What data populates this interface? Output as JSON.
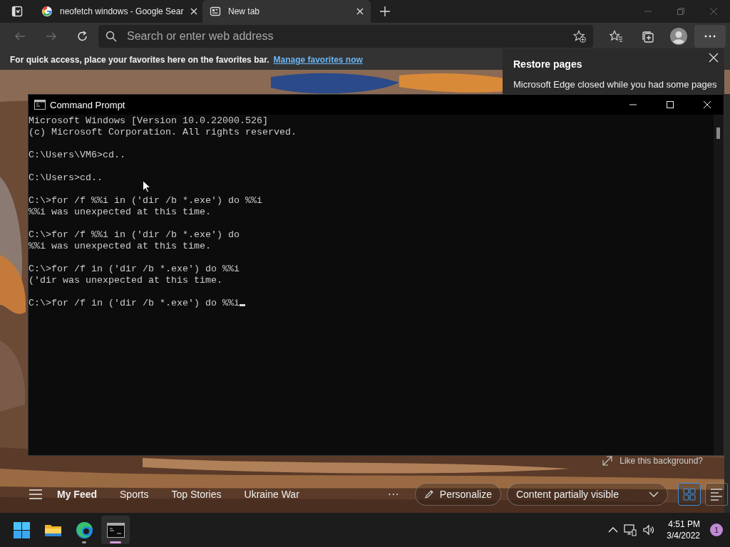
{
  "browser": {
    "tabs": [
      {
        "title": "neofetch windows - Google Sear",
        "kind": "google",
        "selected": false
      },
      {
        "title": "New tab",
        "kind": "newtab",
        "selected": true
      }
    ],
    "nav": [
      {
        "kind": "back",
        "disabled": true
      },
      {
        "kind": "forward",
        "disabled": true
      },
      {
        "kind": "refresh",
        "disabled": false
      }
    ],
    "address": {
      "placeholder": "Search or enter web address"
    },
    "favorites_bar": {
      "text": "For quick access, place your favorites here on the favorites bar.",
      "link": "Manage favorites now"
    },
    "restore_panel": {
      "title": "Restore pages",
      "message": "Microsoft Edge closed while you had some pages"
    },
    "background_prompt": "Like this background?",
    "feed": {
      "tabs": [
        {
          "label": "My Feed",
          "selected": true
        },
        {
          "label": "Sports",
          "selected": false
        },
        {
          "label": "Top Stories",
          "selected": false
        },
        {
          "label": "Ukraine War",
          "selected": false
        }
      ],
      "more": "···",
      "personalize": "Personalize",
      "visibility": "Content partially visible",
      "views": [
        {
          "kind": "grid",
          "selected": true
        },
        {
          "kind": "list",
          "selected": false
        }
      ]
    }
  },
  "console": {
    "title": "Command Prompt",
    "blocks": [
      [
        "Microsoft Windows [Version 10.0.22000.526]",
        "(c) Microsoft Corporation. All rights reserved."
      ],
      [
        "C:\\Users\\VM6>cd.."
      ],
      [
        "C:\\Users>cd.."
      ],
      [
        "C:\\>for /f %%i in ('dir /b *.exe') do %%i",
        "%%i was unexpected at this time."
      ],
      [
        "C:\\>for /f %%i in ('dir /b *.exe') do",
        "%%i was unexpected at this time."
      ],
      [
        "C:\\>for /f in ('dir /b *.exe') do %%i",
        "('dir was unexpected at this time."
      ],
      [
        "C:\\>for /f in ('dir /b *.exe') do %%i"
      ]
    ],
    "cursor": true
  },
  "taskbar": {
    "apps": [
      {
        "kind": "start",
        "running": false,
        "active": false
      },
      {
        "kind": "explorer",
        "running": false,
        "active": false
      },
      {
        "kind": "edge",
        "running": true,
        "active": false
      },
      {
        "kind": "cmd",
        "running": true,
        "active": true
      }
    ],
    "time": "4:51 PM",
    "date": "3/4/2022",
    "notifications": "1"
  }
}
